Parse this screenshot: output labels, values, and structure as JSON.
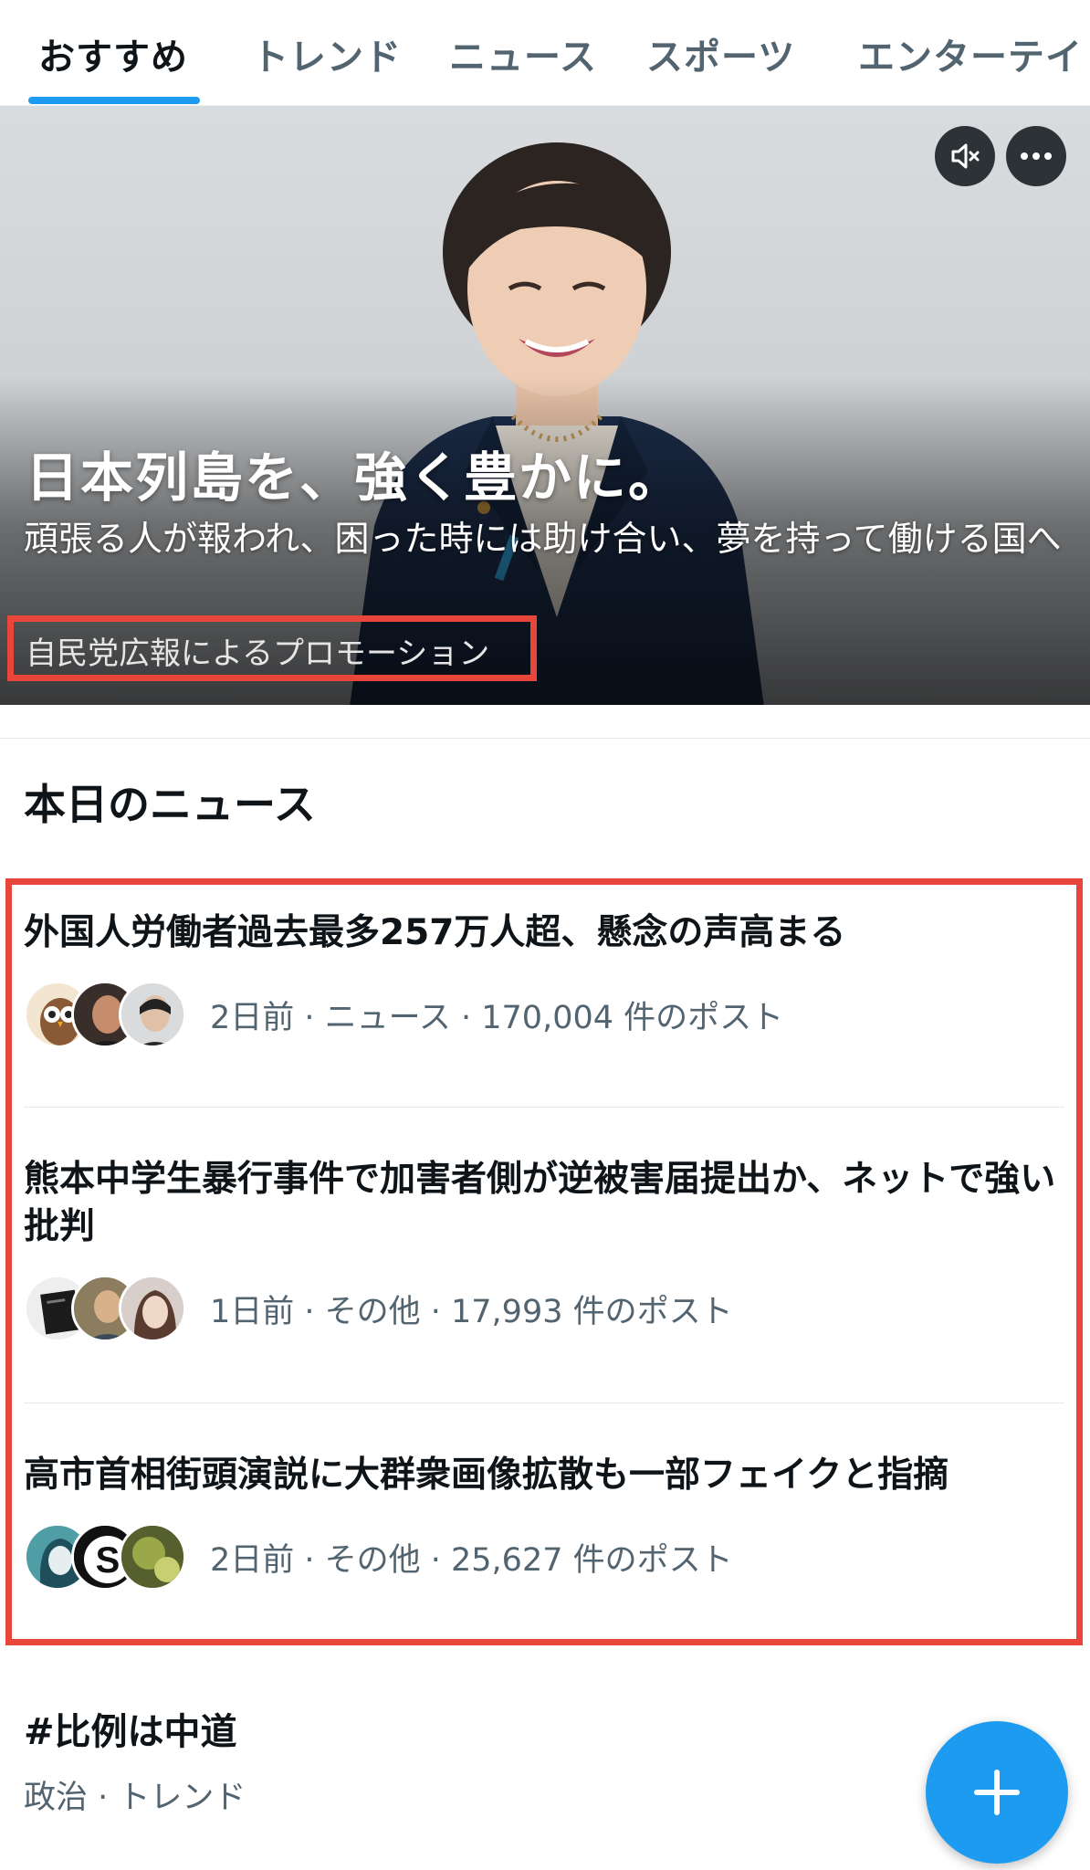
{
  "tabs": [
    {
      "label": "おすすめ"
    },
    {
      "label": "トレンド"
    },
    {
      "label": "ニュース"
    },
    {
      "label": "スポーツ"
    },
    {
      "label": "エンターテイ"
    }
  ],
  "promo": {
    "title": "日本列島を、強く豊かに。",
    "description": "頑張る人が報われ、困った時には助け合い、夢を持って働ける国へ",
    "sponsor": "自民党広報によるプロモーション",
    "mute_icon": "speaker-muted-icon",
    "more_icon": "more-dots-icon"
  },
  "section": {
    "title": "本日のニュース"
  },
  "news": [
    {
      "title": "外国人労働者過去最多257万人超、懸念の声高まる",
      "meta": "2日前 · ニュース · 170,004 件のポスト"
    },
    {
      "title": "熊本中学生暴行事件で加害者側が逆被害届提出か、ネットで強い批判",
      "meta": "1日前 · その他 · 17,993 件のポスト"
    },
    {
      "title": "高市首相街頭演説に大群衆画像拡散も一部フェイクと指摘",
      "meta": "2日前 · その他 · 25,627 件のポスト"
    }
  ],
  "trend": {
    "title": "#比例は中道",
    "meta": "政治 · トレンド"
  },
  "fab": {
    "icon": "plus-icon"
  },
  "colors": {
    "accent": "#1d9bf0",
    "highlight_border": "#e8463b",
    "secondary_text": "#536471"
  }
}
